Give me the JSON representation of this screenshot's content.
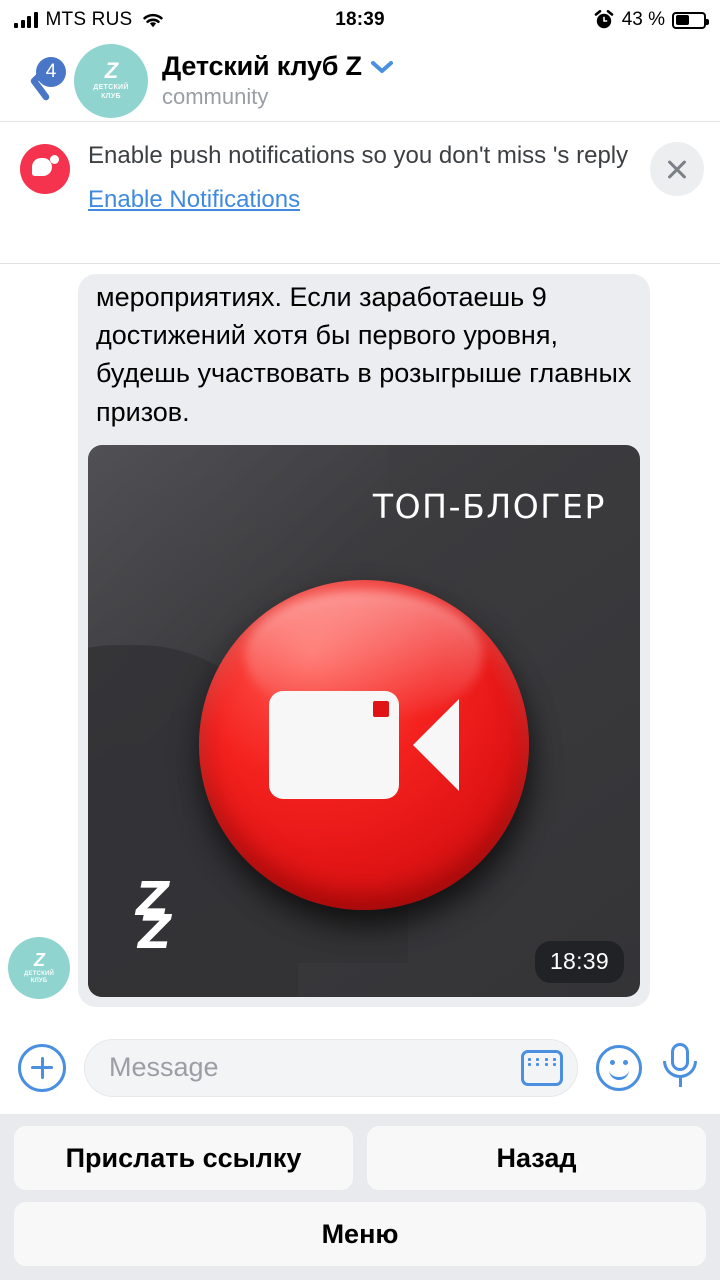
{
  "status_bar": {
    "carrier": "MTS RUS",
    "time": "18:39",
    "battery_percent": "43 %",
    "battery_level": 43,
    "signal_icon": "signal-bars-icon",
    "wifi_icon": "wifi-icon",
    "alarm_icon": "alarm-clock-icon"
  },
  "header": {
    "back_badge": "4",
    "back_icon": "back-arrow-icon",
    "avatar": {
      "mark": "Z",
      "caption_line1": "ДЕТСКИЙ",
      "caption_line2": "КЛУБ",
      "color": "#8fd4cf"
    },
    "title": "Детский клуб Z",
    "chevron_icon": "chevron-down-icon",
    "subtitle": "community"
  },
  "banner": {
    "icon": "notification-bubble-icon",
    "text": "Enable push notifications so you don't miss 's reply",
    "action_label": "Enable Notifications",
    "close_icon": "close-icon",
    "accent_color": "#3f8ae0",
    "icon_color": "#f5334f"
  },
  "message": {
    "avatar": {
      "mark": "Z",
      "caption_line1": "ДЕТСКИЙ",
      "caption_line2": "КЛУБ"
    },
    "text": "мероприятиях. Если заработаешь 9 достижений хотя бы первого уровня, будешь участвовать в розыгрыше главных призов.",
    "timestamp": "18:39",
    "attachment": {
      "title": "ТОП-БЛОГЕР",
      "watermark": "Z",
      "icon": "video-camera-icon",
      "button_color": "#e01414",
      "background_color": "#3b3b3e"
    }
  },
  "input_bar": {
    "attach_icon": "plus-circle-icon",
    "placeholder": "Message",
    "keyboard_icon": "keyboard-icon",
    "emoji_icon": "smiley-icon",
    "mic_icon": "microphone-icon",
    "accent_color": "#4a8fe0"
  },
  "keyboard_buttons": {
    "row1": [
      "Прислать ссылку",
      "Назад"
    ],
    "row2": [
      "Меню"
    ]
  }
}
